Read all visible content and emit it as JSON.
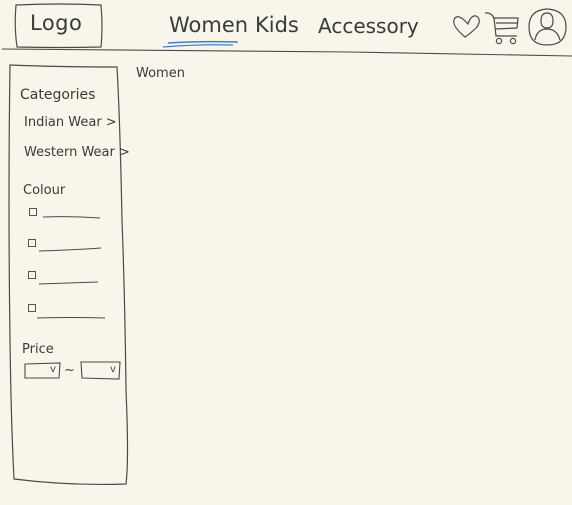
{
  "header": {
    "logo": "Logo",
    "nav": [
      {
        "label": "Women",
        "active": true
      },
      {
        "label": "Kids",
        "active": false
      },
      {
        "label": "Accessory",
        "active": false
      }
    ],
    "icons": [
      "heart-icon",
      "cart-icon",
      "user-avatar-icon"
    ],
    "active_underline_color": "#3d7fd6"
  },
  "main": {
    "title": "Women"
  },
  "sidebar": {
    "categories_title": "Categories",
    "categories": [
      {
        "label": "Indian Wear >"
      },
      {
        "label": "Western Wear >"
      }
    ],
    "colour_title": "Colour",
    "colour_options": [
      {
        "label": ""
      },
      {
        "label": ""
      },
      {
        "label": ""
      },
      {
        "label": ""
      }
    ],
    "price_title": "Price",
    "price_min": {
      "value": "",
      "arrow": "v"
    },
    "price_separator": "~",
    "price_max": {
      "value": "",
      "arrow": "v"
    }
  },
  "colors": {
    "background": "#f8f6ea",
    "ink": "#3a3a3a"
  }
}
